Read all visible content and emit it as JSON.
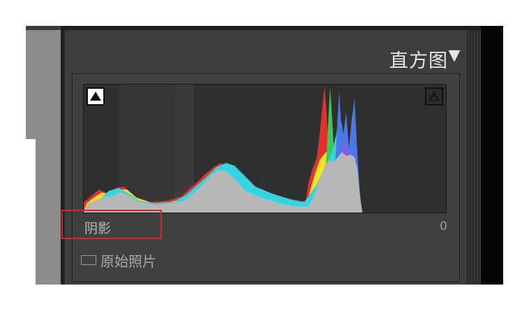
{
  "panel": {
    "title": "直方图",
    "collapse_glyph": "▼"
  },
  "histogram": {
    "shadow_clip_indicator": "white-triangle-icon",
    "highlight_clip_indicator": "dark-triangle-icon",
    "readout_label": "阴影",
    "readout_value": "0"
  },
  "original_photo": {
    "label": "原始照片",
    "checked": false
  },
  "colors": {
    "panel_bg": "#3d3d3d",
    "plot_bg": "#2f2f2f",
    "highlight_box": "#d22a2a",
    "red": "#e0322c",
    "yellow": "#f2e22a",
    "green": "#3fc85a",
    "blue": "#4a78e6",
    "cyan": "#2fd6e0",
    "magenta": "#d63ad6",
    "gray": "#b7b7b7"
  }
}
